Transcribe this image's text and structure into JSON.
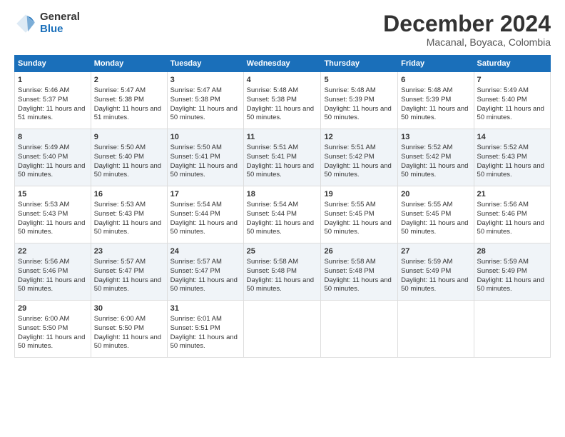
{
  "logo": {
    "general": "General",
    "blue": "Blue"
  },
  "title": "December 2024",
  "location": "Macanal, Boyaca, Colombia",
  "days_of_week": [
    "Sunday",
    "Monday",
    "Tuesday",
    "Wednesday",
    "Thursday",
    "Friday",
    "Saturday"
  ],
  "weeks": [
    [
      {
        "day": "1",
        "sunrise": "5:46 AM",
        "sunset": "5:37 PM",
        "daylight": "11 hours and 51 minutes."
      },
      {
        "day": "2",
        "sunrise": "5:47 AM",
        "sunset": "5:38 PM",
        "daylight": "11 hours and 51 minutes."
      },
      {
        "day": "3",
        "sunrise": "5:47 AM",
        "sunset": "5:38 PM",
        "daylight": "11 hours and 50 minutes."
      },
      {
        "day": "4",
        "sunrise": "5:48 AM",
        "sunset": "5:38 PM",
        "daylight": "11 hours and 50 minutes."
      },
      {
        "day": "5",
        "sunrise": "5:48 AM",
        "sunset": "5:39 PM",
        "daylight": "11 hours and 50 minutes."
      },
      {
        "day": "6",
        "sunrise": "5:48 AM",
        "sunset": "5:39 PM",
        "daylight": "11 hours and 50 minutes."
      },
      {
        "day": "7",
        "sunrise": "5:49 AM",
        "sunset": "5:40 PM",
        "daylight": "11 hours and 50 minutes."
      }
    ],
    [
      {
        "day": "8",
        "sunrise": "5:49 AM",
        "sunset": "5:40 PM",
        "daylight": "11 hours and 50 minutes."
      },
      {
        "day": "9",
        "sunrise": "5:50 AM",
        "sunset": "5:40 PM",
        "daylight": "11 hours and 50 minutes."
      },
      {
        "day": "10",
        "sunrise": "5:50 AM",
        "sunset": "5:41 PM",
        "daylight": "11 hours and 50 minutes."
      },
      {
        "day": "11",
        "sunrise": "5:51 AM",
        "sunset": "5:41 PM",
        "daylight": "11 hours and 50 minutes."
      },
      {
        "day": "12",
        "sunrise": "5:51 AM",
        "sunset": "5:42 PM",
        "daylight": "11 hours and 50 minutes."
      },
      {
        "day": "13",
        "sunrise": "5:52 AM",
        "sunset": "5:42 PM",
        "daylight": "11 hours and 50 minutes."
      },
      {
        "day": "14",
        "sunrise": "5:52 AM",
        "sunset": "5:43 PM",
        "daylight": "11 hours and 50 minutes."
      }
    ],
    [
      {
        "day": "15",
        "sunrise": "5:53 AM",
        "sunset": "5:43 PM",
        "daylight": "11 hours and 50 minutes."
      },
      {
        "day": "16",
        "sunrise": "5:53 AM",
        "sunset": "5:43 PM",
        "daylight": "11 hours and 50 minutes."
      },
      {
        "day": "17",
        "sunrise": "5:54 AM",
        "sunset": "5:44 PM",
        "daylight": "11 hours and 50 minutes."
      },
      {
        "day": "18",
        "sunrise": "5:54 AM",
        "sunset": "5:44 PM",
        "daylight": "11 hours and 50 minutes."
      },
      {
        "day": "19",
        "sunrise": "5:55 AM",
        "sunset": "5:45 PM",
        "daylight": "11 hours and 50 minutes."
      },
      {
        "day": "20",
        "sunrise": "5:55 AM",
        "sunset": "5:45 PM",
        "daylight": "11 hours and 50 minutes."
      },
      {
        "day": "21",
        "sunrise": "5:56 AM",
        "sunset": "5:46 PM",
        "daylight": "11 hours and 50 minutes."
      }
    ],
    [
      {
        "day": "22",
        "sunrise": "5:56 AM",
        "sunset": "5:46 PM",
        "daylight": "11 hours and 50 minutes."
      },
      {
        "day": "23",
        "sunrise": "5:57 AM",
        "sunset": "5:47 PM",
        "daylight": "11 hours and 50 minutes."
      },
      {
        "day": "24",
        "sunrise": "5:57 AM",
        "sunset": "5:47 PM",
        "daylight": "11 hours and 50 minutes."
      },
      {
        "day": "25",
        "sunrise": "5:58 AM",
        "sunset": "5:48 PM",
        "daylight": "11 hours and 50 minutes."
      },
      {
        "day": "26",
        "sunrise": "5:58 AM",
        "sunset": "5:48 PM",
        "daylight": "11 hours and 50 minutes."
      },
      {
        "day": "27",
        "sunrise": "5:59 AM",
        "sunset": "5:49 PM",
        "daylight": "11 hours and 50 minutes."
      },
      {
        "day": "28",
        "sunrise": "5:59 AM",
        "sunset": "5:49 PM",
        "daylight": "11 hours and 50 minutes."
      }
    ],
    [
      {
        "day": "29",
        "sunrise": "6:00 AM",
        "sunset": "5:50 PM",
        "daylight": "11 hours and 50 minutes."
      },
      {
        "day": "30",
        "sunrise": "6:00 AM",
        "sunset": "5:50 PM",
        "daylight": "11 hours and 50 minutes."
      },
      {
        "day": "31",
        "sunrise": "6:01 AM",
        "sunset": "5:51 PM",
        "daylight": "11 hours and 50 minutes."
      },
      null,
      null,
      null,
      null
    ]
  ],
  "labels": {
    "sunrise": "Sunrise:",
    "sunset": "Sunset:",
    "daylight": "Daylight:"
  }
}
